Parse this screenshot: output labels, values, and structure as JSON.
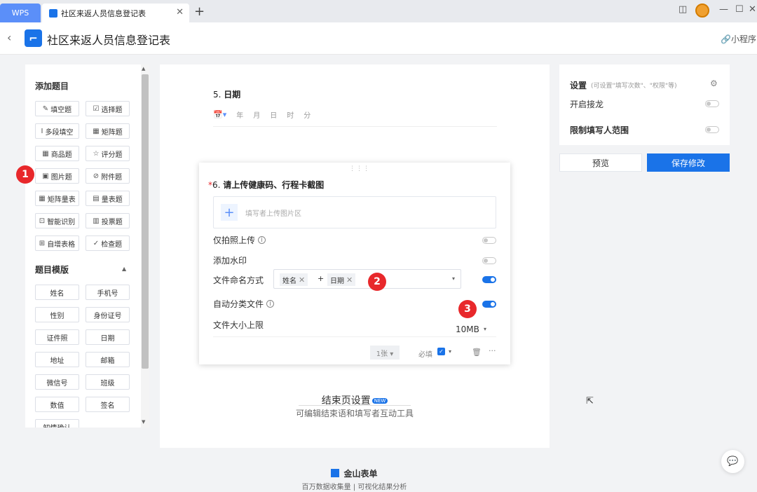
{
  "window": {
    "wps_tab": "WPS",
    "doc_tab": "社区来返人员信息登记表",
    "close": "✕",
    "new_tab": "+",
    "icons": {
      "layout": "layout-icon",
      "minimize": "—",
      "maximize": "☐",
      "close": "✕"
    }
  },
  "appbar": {
    "back": "‹",
    "logo": "⌐",
    "title": "社区来返人员信息登记表",
    "miniprogram": "小程序"
  },
  "left": {
    "add_title": "添加题目",
    "types": [
      {
        "label": "填空题",
        "icon": "✎"
      },
      {
        "label": "选择题",
        "icon": "☑"
      },
      {
        "label": "多段填空",
        "icon": "Ⅰ"
      },
      {
        "label": "矩阵题",
        "icon": "▦"
      },
      {
        "label": "商品题",
        "icon": "▦"
      },
      {
        "label": "评分题",
        "icon": "☆"
      },
      {
        "label": "图片题",
        "icon": "▣"
      },
      {
        "label": "附件题",
        "icon": "⊘"
      },
      {
        "label": "矩阵量表",
        "icon": "▦"
      },
      {
        "label": "量表题",
        "icon": "▤"
      },
      {
        "label": "智能识别",
        "icon": "⊡"
      },
      {
        "label": "投票题",
        "icon": "▥"
      },
      {
        "label": "自增表格",
        "icon": "⊞"
      },
      {
        "label": "检查题",
        "icon": "✓"
      }
    ],
    "template_title": "题目模版",
    "collapse": "▲",
    "templates": [
      "姓名",
      "手机号",
      "性别",
      "身份证号",
      "证件照",
      "日期",
      "地址",
      "邮箱",
      "微信号",
      "班级",
      "数值",
      "签名",
      "知情确认"
    ]
  },
  "badges": [
    "1",
    "2",
    "3"
  ],
  "q5": {
    "num": "5.",
    "title": "日期",
    "cal": "📅▾",
    "units": [
      "年",
      "月",
      "日",
      "时",
      "分"
    ]
  },
  "q6": {
    "star": "*",
    "num": "6.",
    "title": "请上传健康码、行程卡截图",
    "drag": "⋮⋮⋮",
    "upload_plus": "+",
    "upload_placeholder": "填写者上传图片区",
    "opt_photo": "仅拍照上传",
    "opt_watermark": "添加水印",
    "opt_filename": "文件命名方式",
    "tag1": "姓名",
    "tag2": "日期",
    "tag_x": "✕",
    "tag_plus": "+",
    "select_arrow": "▾",
    "opt_autosort": "自动分类文件",
    "opt_size": "文件大小上限",
    "size_value": "10MB",
    "size_arrow": "▾",
    "count": "1张 ▾",
    "required": "必填",
    "check": "✓",
    "check_arrow": "▾",
    "trash": "🗑",
    "more": "···",
    "info": "i"
  },
  "end": {
    "title": "结束页设置",
    "new": "NEW",
    "desc": "可编辑结束语和填写者互动工具"
  },
  "right": {
    "title": "设置",
    "hint": "(可设置\"填写次数\"、\"权限\"等)",
    "gear": "⚙",
    "row1": "开启接龙",
    "row2": "限制填写人范围",
    "preview": "预览",
    "save": "保存修改"
  },
  "footer": {
    "brand": "金山表单",
    "slogan": "百万数据收集量 | 可视化结果分析"
  },
  "misc": {
    "cursor": "⇱",
    "chat": "💬"
  }
}
